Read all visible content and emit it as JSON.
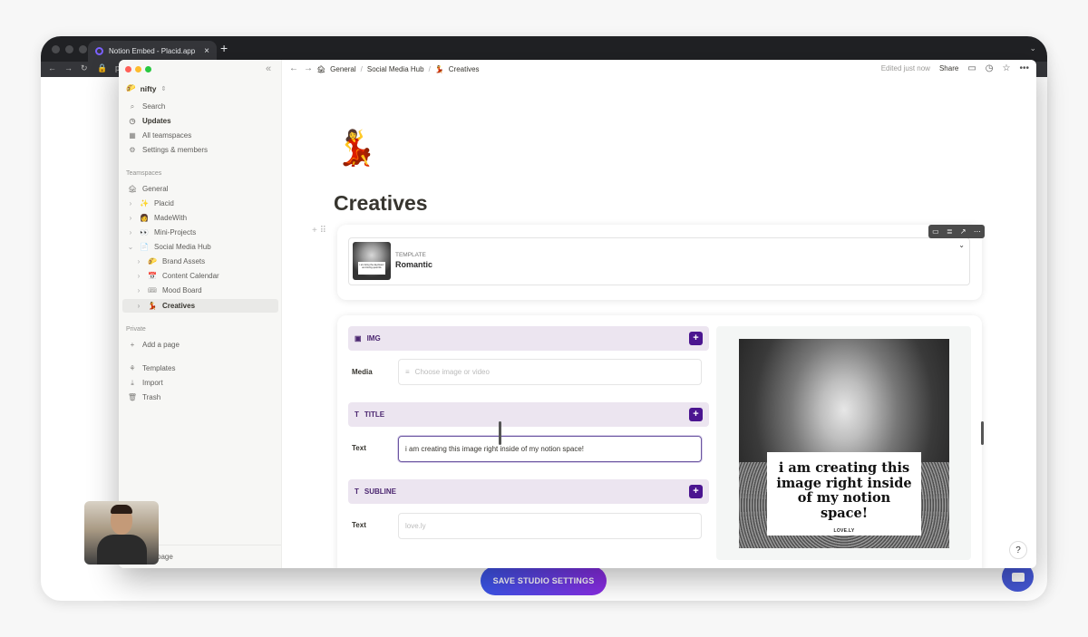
{
  "browser": {
    "tab_title": "Notion Embed - Placid.app",
    "new_tab": "+",
    "close": "×",
    "url_fragment": "p"
  },
  "sidebar": {
    "workspace": "nifty",
    "workspace_icon": "🌮",
    "nav": [
      {
        "label": "Search",
        "icon": "search-icon",
        "glyph": "⌕"
      },
      {
        "label": "Updates",
        "icon": "clock-icon",
        "glyph": "◷"
      },
      {
        "label": "All teamspaces",
        "icon": "grid-icon",
        "glyph": "▦"
      },
      {
        "label": "Settings & members",
        "icon": "gear-icon",
        "glyph": "⚙"
      }
    ],
    "teamspaces_heading": "Teamspaces",
    "teamspaces": [
      {
        "label": "General",
        "emoji": "🏚"
      },
      {
        "label": "Placid",
        "emoji": "✨"
      },
      {
        "label": "MadeWith",
        "emoji": "👩"
      },
      {
        "label": "Mini-Projects",
        "emoji": "👀"
      },
      {
        "label": "Social Media Hub",
        "emoji": "📄"
      },
      {
        "label": "Brand Assets",
        "emoji": "🌮"
      },
      {
        "label": "Content Calendar",
        "emoji": "📅"
      },
      {
        "label": "Mood Board",
        "emoji": "🎟"
      },
      {
        "label": "Creatives",
        "emoji": "💃"
      }
    ],
    "private_heading": "Private",
    "add_page": "Add a page",
    "bottom_items": [
      {
        "label": "Templates",
        "glyph": "⚘"
      },
      {
        "label": "Import",
        "glyph": "⤓"
      },
      {
        "label": "Trash",
        "glyph": "🗑"
      }
    ],
    "new_page": "page"
  },
  "topbar": {
    "crumbs": [
      "General",
      "Social Media Hub",
      "Creatives"
    ],
    "crumb_sep": "/",
    "edited": "Edited just now",
    "share": "Share"
  },
  "page": {
    "icon": "💃",
    "title": "Creatives"
  },
  "template": {
    "label": "TEMPLATE",
    "name": "Romantic",
    "thumb_text": "i am living the daydream and loving quiet life"
  },
  "form": {
    "sections": [
      {
        "title": "IMG",
        "icon": "image-icon",
        "glyph": "▣"
      },
      {
        "title": "TITLE",
        "icon": "text-icon",
        "glyph": "T"
      },
      {
        "title": "SUBLINE",
        "icon": "text-icon",
        "glyph": "T"
      }
    ],
    "media_label": "Media",
    "media_placeholder": "Choose image or video",
    "title_label": "Text",
    "title_value": "i am creating this image right inside of my notion space!",
    "subline_label": "Text",
    "subline_placeholder": "love.ly"
  },
  "preview": {
    "title": "i am creating this image right inside of my notion space!",
    "subline": "LOVE.LY"
  },
  "buttons": {
    "save": "SAVE STUDIO SETTINGS",
    "help": "?"
  },
  "colors": {
    "accent": "#4b1590",
    "section_bg": "#ece5f0",
    "save_gradient_start": "#3a56e8",
    "save_gradient_end": "#8a2be2"
  }
}
